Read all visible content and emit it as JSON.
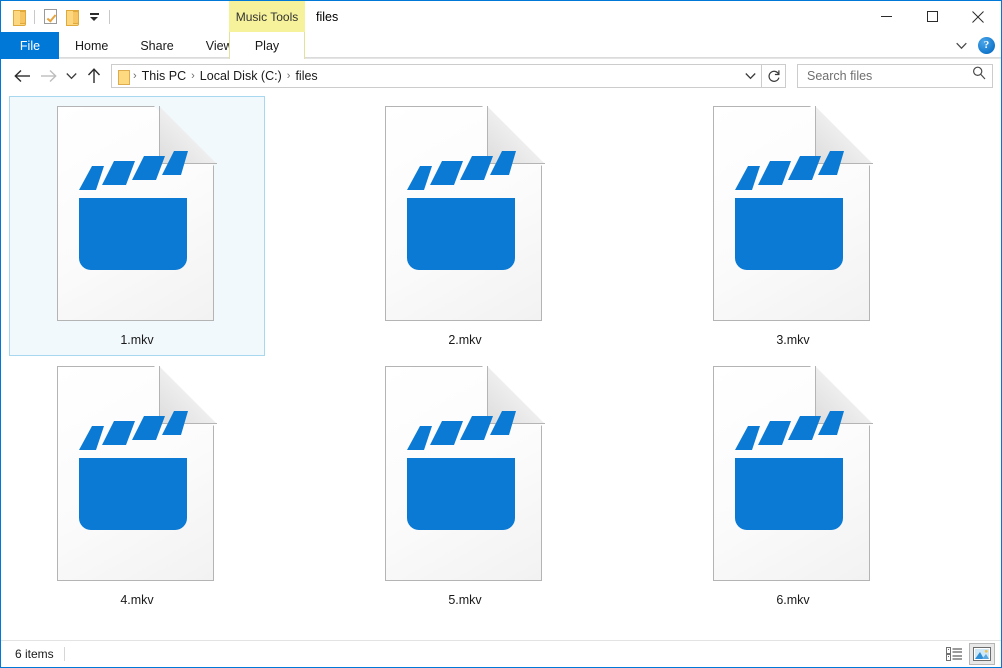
{
  "window": {
    "title": "files",
    "accent_color": "#0078d7",
    "contextual_tools_label": "Music Tools",
    "contextual_tools_color": "#f6f19b"
  },
  "quick_access_toolbar": {
    "items": [
      {
        "name": "folder-icon",
        "tooltip": "Pin to Quick access"
      },
      {
        "name": "properties-icon",
        "tooltip": "Properties"
      },
      {
        "name": "new-folder-icon",
        "tooltip": "New folder"
      },
      {
        "name": "chevron-down-icon",
        "tooltip": "Customize Quick Access Toolbar"
      }
    ]
  },
  "window_controls": {
    "minimize": "Minimize",
    "maximize": "Maximize",
    "close": "Close"
  },
  "ribbon": {
    "tabs": [
      {
        "label": "File",
        "selected": true
      },
      {
        "label": "Home",
        "selected": false
      },
      {
        "label": "Share",
        "selected": false
      },
      {
        "label": "View",
        "selected": false
      }
    ],
    "contextual_tab": {
      "label": "Play",
      "selected": false
    },
    "expand_label": "Expand the Ribbon",
    "help_label": "?"
  },
  "address_bar": {
    "back": "Back",
    "forward": "Forward",
    "recent": "Recent locations",
    "up": "Up one level",
    "breadcrumbs": [
      {
        "label": "This PC"
      },
      {
        "label": "Local Disk (C:)"
      },
      {
        "label": "files"
      }
    ],
    "separator": "›",
    "dropdown": "Previous Locations",
    "refresh": "Refresh"
  },
  "search": {
    "placeholder": "Search files",
    "value": "",
    "icon": "search-icon"
  },
  "files": [
    {
      "name": "1.mkv",
      "type": "mkv-video-file",
      "selected": true
    },
    {
      "name": "2.mkv",
      "type": "mkv-video-file",
      "selected": false
    },
    {
      "name": "3.mkv",
      "type": "mkv-video-file",
      "selected": false
    },
    {
      "name": "4.mkv",
      "type": "mkv-video-file",
      "selected": false
    },
    {
      "name": "5.mkv",
      "type": "mkv-video-file",
      "selected": false
    },
    {
      "name": "6.mkv",
      "type": "mkv-video-file",
      "selected": false
    }
  ],
  "file_icon": {
    "clapper_color": "#0b7ad4",
    "page_color": "#ffffff",
    "page_border": "#b4b4b4"
  },
  "status_bar": {
    "item_count_text": "6 items",
    "views": [
      {
        "name": "details-view-button",
        "label": "Details view",
        "active": false
      },
      {
        "name": "large-icons-view-button",
        "label": "Large icons view",
        "active": true
      }
    ]
  }
}
